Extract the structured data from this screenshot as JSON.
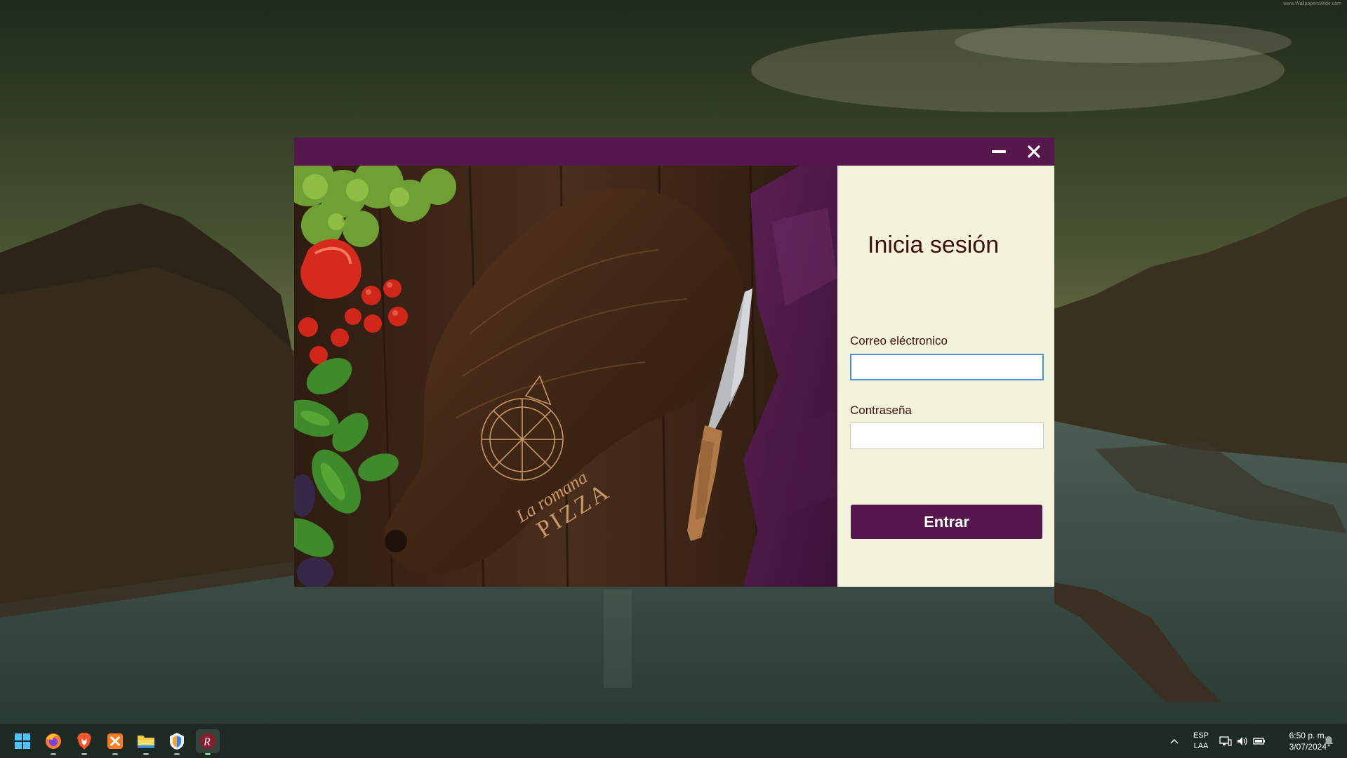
{
  "desktop": {
    "watermark": "www.WallpapersWide.com"
  },
  "window": {
    "titlebar": {
      "minimize_icon": "minimize-icon",
      "close_icon": "close-icon",
      "accent": "#56174c"
    },
    "hero_image": {
      "description_icon": "pizza-board-photo",
      "engraving_line1": "La romana",
      "engraving_line2": "PIZZA"
    },
    "login": {
      "heading": "Inicia sesión",
      "email_label": "Correo eléctronico",
      "email_value": "",
      "password_label": "Contraseña",
      "password_value": "",
      "submit_label": "Entrar"
    }
  },
  "taskbar": {
    "apps": [
      {
        "name": "windows-start-icon"
      },
      {
        "name": "firefox-icon"
      },
      {
        "name": "brave-icon"
      },
      {
        "name": "xampp-icon"
      },
      {
        "name": "file-explorer-icon"
      },
      {
        "name": "app-shield-icon"
      },
      {
        "name": "laromana-app-icon"
      }
    ],
    "tray": {
      "lang_line1": "ESP",
      "lang_line2": "LAA",
      "time": "6:50 p. m.",
      "date": "3/07/2024"
    }
  }
}
